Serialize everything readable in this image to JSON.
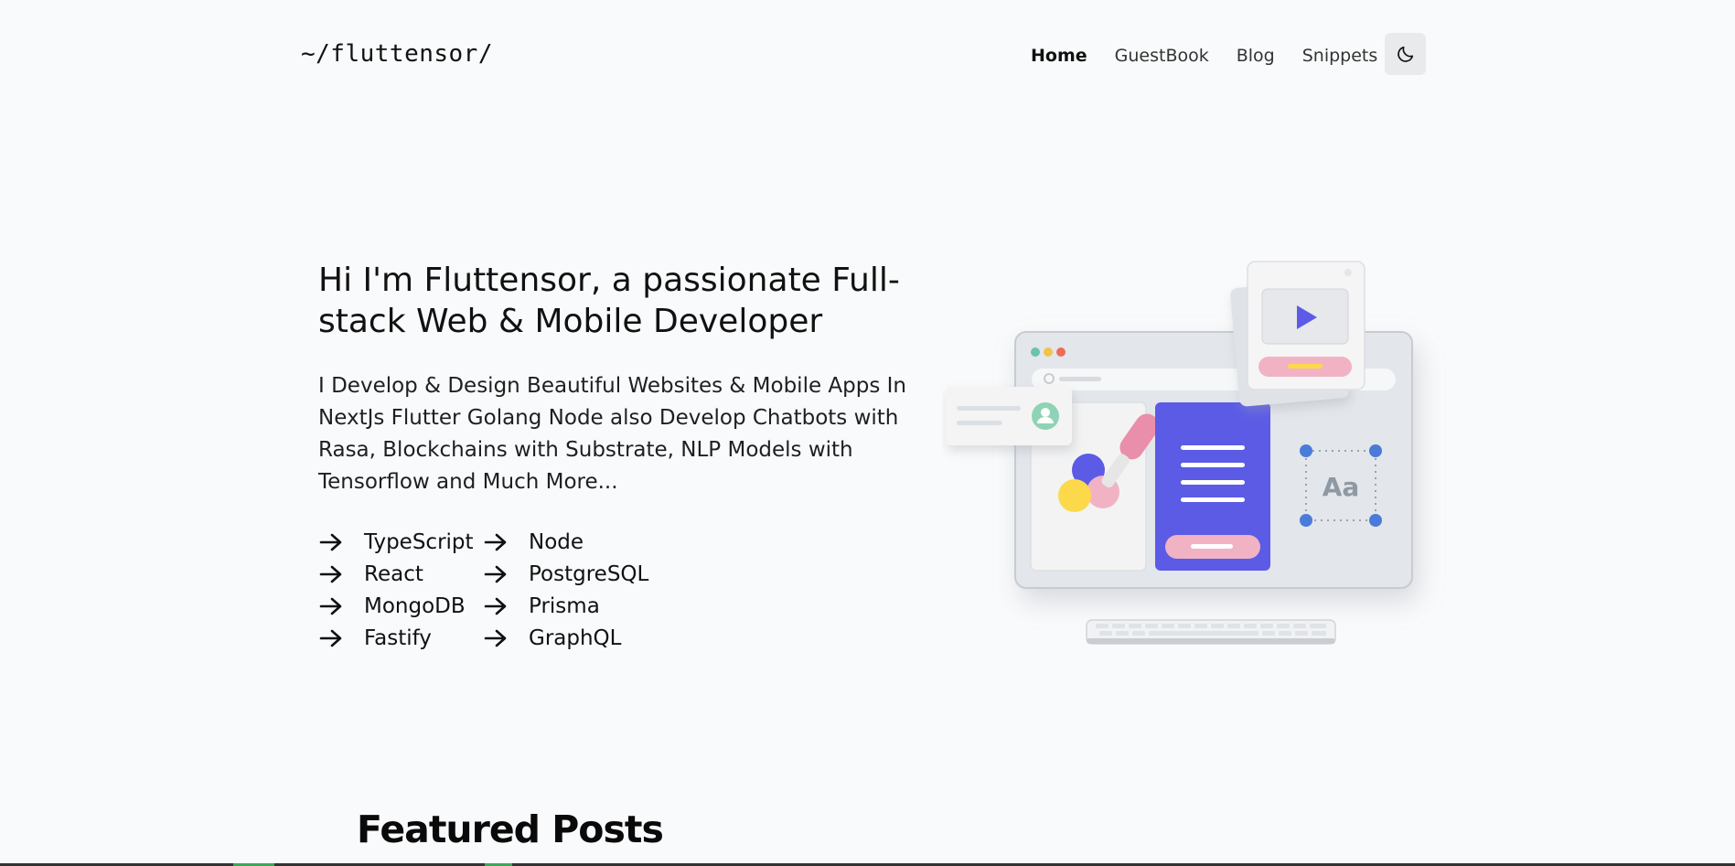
{
  "header": {
    "logo": "~/fluttensor/",
    "nav": [
      {
        "label": "Home",
        "active": true
      },
      {
        "label": "GuestBook",
        "active": false
      },
      {
        "label": "Blog",
        "active": false
      },
      {
        "label": "Snippets",
        "active": false
      }
    ],
    "theme_toggle_icon": "moon-icon"
  },
  "hero": {
    "title": "Hi I'm Fluttensor, a passionate Full-stack Web & Mobile Developer",
    "description": "I Develop & Design Beautiful Websites & Mobile Apps In NextJs Flutter Golang Node also Develop Chatbots with Rasa, Blockchains with Substrate, NLP Models with Tensorflow and Much More...",
    "skills": [
      "TypeScript",
      "Node",
      "React",
      "PostgreSQL",
      "MongoDB",
      "Prisma",
      "Fastify",
      "GraphQL"
    ],
    "illustration": {
      "badge_text": "Aa",
      "icons": [
        "play-icon",
        "user-icon",
        "search-icon"
      ]
    }
  },
  "featured": {
    "heading": "Featured Posts"
  },
  "colors": {
    "background": "#f9fafb",
    "accent": "#5b5be6",
    "pink": "#f1b3c4",
    "yellow": "#fbd94a"
  }
}
